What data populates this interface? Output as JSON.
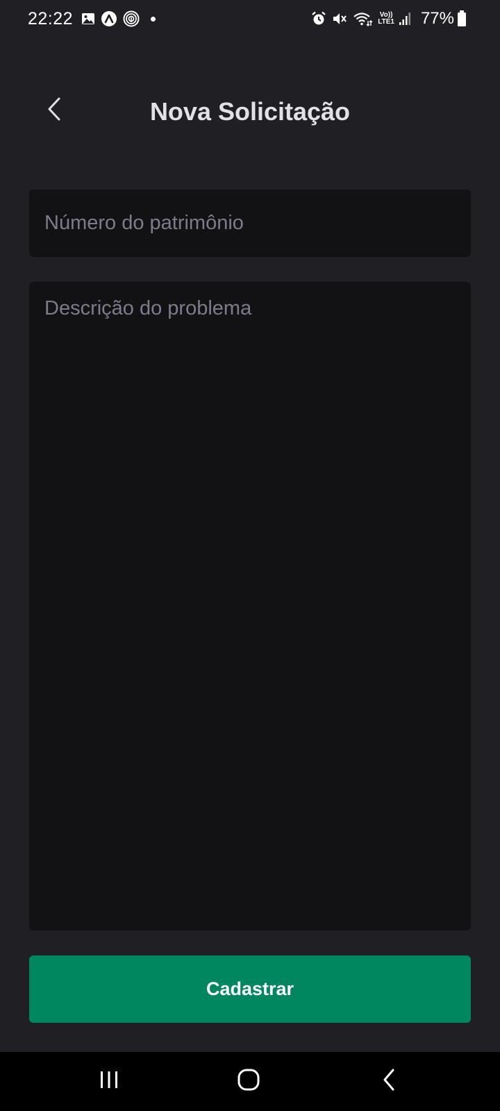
{
  "status_bar": {
    "time": "22:22",
    "network_top": "Vo))",
    "network_bottom": "LTE1",
    "battery": "77%",
    "left_icons": [
      "gallery-icon",
      "app-notification-icon",
      "fingerprint-app-icon",
      "notification-dot"
    ],
    "right_icons": [
      "alarm-icon",
      "mute-icon",
      "wifi-icon",
      "volte-lte-icon",
      "signal-icon",
      "battery-icon"
    ]
  },
  "header": {
    "title": "Nova Solicitação",
    "back_icon": "chevron-left-icon"
  },
  "form": {
    "patrimonio": {
      "value": "",
      "placeholder": "Número do patrimônio"
    },
    "descricao": {
      "value": "",
      "placeholder": "Descrição do problema"
    },
    "submit_label": "Cadastrar"
  },
  "nav_bar": {
    "items": [
      "recents-icon",
      "home-icon",
      "back-icon"
    ]
  },
  "colors": {
    "background": "#202024",
    "field_background": "#121214",
    "accent": "#00875f",
    "placeholder": "#7c7c8a",
    "text": "#e1e1e6"
  }
}
